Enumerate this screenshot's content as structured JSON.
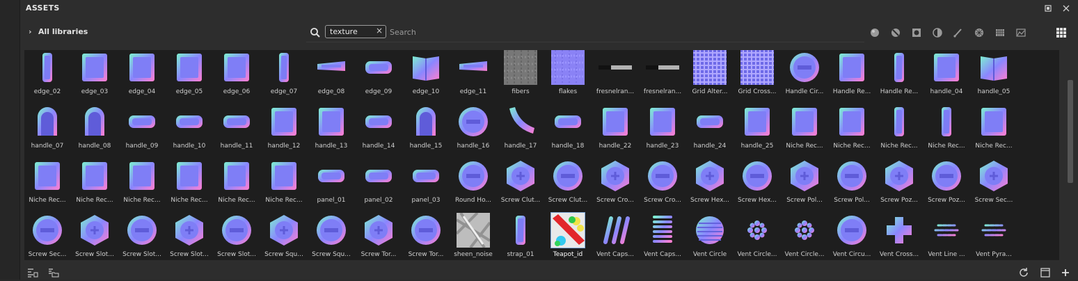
{
  "panel": {
    "title": "ASSETS"
  },
  "window": {
    "undock_icon": "undock-icon",
    "close_icon": "close-icon"
  },
  "toolbar": {
    "libraries_label": "All libraries"
  },
  "search": {
    "chip": "texture",
    "placeholder": "Search"
  },
  "filters": [
    "material-filter-icon",
    "smart-material-filter-icon",
    "environment-filter-icon",
    "smart-mask-filter-icon",
    "brush-filter-icon",
    "texture-filter-icon",
    "alpha-filter-icon",
    "procedural-filter-icon"
  ],
  "colors": {
    "panel_bg": "#2d2d2d",
    "grid_bg": "#1e1e1e",
    "normal_blue": "#8080ff",
    "selection": "#7fa8d8"
  },
  "assets": [
    [
      {
        "label": "edge_02",
        "shape": "vbar"
      },
      {
        "label": "edge_03",
        "shape": "rect"
      },
      {
        "label": "edge_04",
        "shape": "rect"
      },
      {
        "label": "edge_05",
        "shape": "rect"
      },
      {
        "label": "edge_06",
        "shape": "rect"
      },
      {
        "label": "edge_07",
        "shape": "vbar"
      },
      {
        "label": "edge_08",
        "shape": "trap"
      },
      {
        "label": "edge_09",
        "shape": "pill"
      },
      {
        "label": "edge_10",
        "shape": "book"
      },
      {
        "label": "edge_11",
        "shape": "trap"
      },
      {
        "label": "fibers",
        "shape": "noise"
      },
      {
        "label": "flakes",
        "shape": "flakes"
      },
      {
        "label": "fresnelran...",
        "shape": "gradient"
      },
      {
        "label": "fresnelran...",
        "shape": "gradient"
      },
      {
        "label": "Grid Alter...",
        "shape": "grid"
      },
      {
        "label": "Grid Cross...",
        "shape": "grid"
      },
      {
        "label": "Handle Cir...",
        "shape": "circle"
      },
      {
        "label": "Handle Re...",
        "shape": "rect"
      },
      {
        "label": "Handle Re...",
        "shape": "vbar"
      },
      {
        "label": "handle_04",
        "shape": "rect"
      },
      {
        "label": "handle_05",
        "shape": "book"
      }
    ],
    [
      {
        "label": "handle_07",
        "shape": "arch"
      },
      {
        "label": "handle_08",
        "shape": "arch"
      },
      {
        "label": "handle_09",
        "shape": "pill"
      },
      {
        "label": "handle_10",
        "shape": "pill"
      },
      {
        "label": "handle_11",
        "shape": "pill"
      },
      {
        "label": "handle_12",
        "shape": "rect"
      },
      {
        "label": "handle_13",
        "shape": "rect"
      },
      {
        "label": "handle_14",
        "shape": "pill"
      },
      {
        "label": "handle_15",
        "shape": "arch"
      },
      {
        "label": "handle_16",
        "shape": "circle"
      },
      {
        "label": "handle_17",
        "shape": "curve"
      },
      {
        "label": "handle_18",
        "shape": "pill"
      },
      {
        "label": "handle_22",
        "shape": "rect"
      },
      {
        "label": "handle_23",
        "shape": "rect"
      },
      {
        "label": "handle_24",
        "shape": "pill"
      },
      {
        "label": "handle_25",
        "shape": "rect"
      },
      {
        "label": "Niche Rec...",
        "shape": "rect"
      },
      {
        "label": "Niche Rec...",
        "shape": "rect"
      },
      {
        "label": "Niche Rec...",
        "shape": "vbar"
      },
      {
        "label": "Niche Rec...",
        "shape": "vbar"
      },
      {
        "label": "Niche Rec...",
        "shape": "rect"
      }
    ],
    [
      {
        "label": "Niche Rec...",
        "shape": "rect"
      },
      {
        "label": "Niche Rec...",
        "shape": "rect"
      },
      {
        "label": "Niche Rec...",
        "shape": "rect"
      },
      {
        "label": "Niche Rec...",
        "shape": "rect"
      },
      {
        "label": "Niche Rec...",
        "shape": "rect"
      },
      {
        "label": "Niche Rec...",
        "shape": "rect"
      },
      {
        "label": "panel_01",
        "shape": "pill"
      },
      {
        "label": "panel_02",
        "shape": "pill"
      },
      {
        "label": "panel_03",
        "shape": "pill"
      },
      {
        "label": "Round Ho...",
        "shape": "circle"
      },
      {
        "label": "Screw Clut...",
        "shape": "hex"
      },
      {
        "label": "Screw Clut...",
        "shape": "circle"
      },
      {
        "label": "Screw Cro...",
        "shape": "hex"
      },
      {
        "label": "Screw Cro...",
        "shape": "circle"
      },
      {
        "label": "Screw Hex...",
        "shape": "hex"
      },
      {
        "label": "Screw Hex...",
        "shape": "circle"
      },
      {
        "label": "Screw Pol...",
        "shape": "hex"
      },
      {
        "label": "Screw Pol...",
        "shape": "circle"
      },
      {
        "label": "Screw Poz...",
        "shape": "hex"
      },
      {
        "label": "Screw Poz...",
        "shape": "circle"
      },
      {
        "label": "Screw Sec...",
        "shape": "hex"
      }
    ],
    [
      {
        "label": "Screw Sec...",
        "shape": "circle"
      },
      {
        "label": "Screw Slot...",
        "shape": "hex"
      },
      {
        "label": "Screw Slot...",
        "shape": "circle"
      },
      {
        "label": "Screw Slot...",
        "shape": "hex"
      },
      {
        "label": "Screw Slot...",
        "shape": "circle"
      },
      {
        "label": "Screw Squ...",
        "shape": "hex"
      },
      {
        "label": "Screw Squ...",
        "shape": "circle"
      },
      {
        "label": "Screw Tor...",
        "shape": "hex"
      },
      {
        "label": "Screw Tor...",
        "shape": "circle"
      },
      {
        "label": "sheen_noise",
        "shape": "sheen"
      },
      {
        "label": "strap_01",
        "shape": "vbar"
      },
      {
        "label": "Teapot_id",
        "shape": "teapot",
        "selected": true
      },
      {
        "label": "Vent Caps...",
        "shape": "slots"
      },
      {
        "label": "Vent Caps...",
        "shape": "hslots"
      },
      {
        "label": "Vent Circle",
        "shape": "vcircle"
      },
      {
        "label": "Vent Circle...",
        "shape": "dots"
      },
      {
        "label": "Vent Circle...",
        "shape": "dots"
      },
      {
        "label": "Vent Circu...",
        "shape": "circle"
      },
      {
        "label": "Vent Cross...",
        "shape": "cross"
      },
      {
        "label": "Vent Line ...",
        "shape": "lines"
      },
      {
        "label": "Vent Pyra...",
        "shape": "lines"
      }
    ]
  ],
  "bottom": {
    "left_icons": [
      "list-view-icon",
      "folder-view-icon"
    ],
    "right_icons": [
      "refresh-icon",
      "new-window-icon",
      "add-icon"
    ]
  }
}
